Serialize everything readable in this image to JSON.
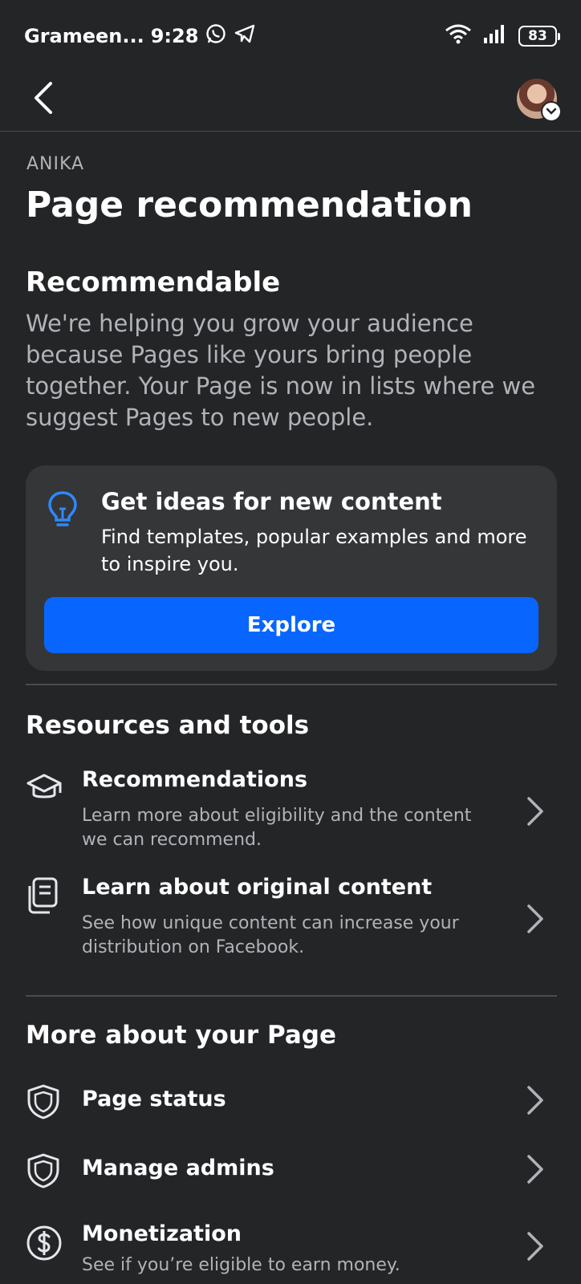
{
  "status": {
    "carrier": "Grameen...",
    "time": "9:28",
    "battery": "83"
  },
  "header": {
    "eyebrow": "ANIKA",
    "title": "Page recommendation"
  },
  "recommendable": {
    "heading": "Recommendable",
    "description": "We're helping you grow your audience because Pages like yours bring people together. Your Page is now in lists where we suggest Pages to new people."
  },
  "ideas_card": {
    "title": "Get ideas for new content",
    "text": "Find templates, popular examples and more to inspire you.",
    "button_label": "Explore"
  },
  "resources": {
    "heading": "Resources and tools",
    "items": [
      {
        "title": "Recommendations",
        "subtitle": "Learn more about eligibility and the content we can recommend.",
        "icon": "graduation-cap-icon"
      },
      {
        "title": "Learn about original content",
        "subtitle": "See how unique content can increase your distribution on Facebook.",
        "icon": "document-copy-icon"
      }
    ]
  },
  "more": {
    "heading": "More about your Page",
    "items": [
      {
        "title": "Page status",
        "icon": "shield-icon"
      },
      {
        "title": "Manage admins",
        "icon": "shield-icon"
      },
      {
        "title": "Monetization",
        "subtitle": "See if you’re eligible to earn money.",
        "icon": "dollar-circle-icon"
      }
    ]
  },
  "colors": {
    "background": "#242527",
    "card": "#353638",
    "accent": "#0866ff",
    "secondary_text": "#b0b3b8"
  }
}
